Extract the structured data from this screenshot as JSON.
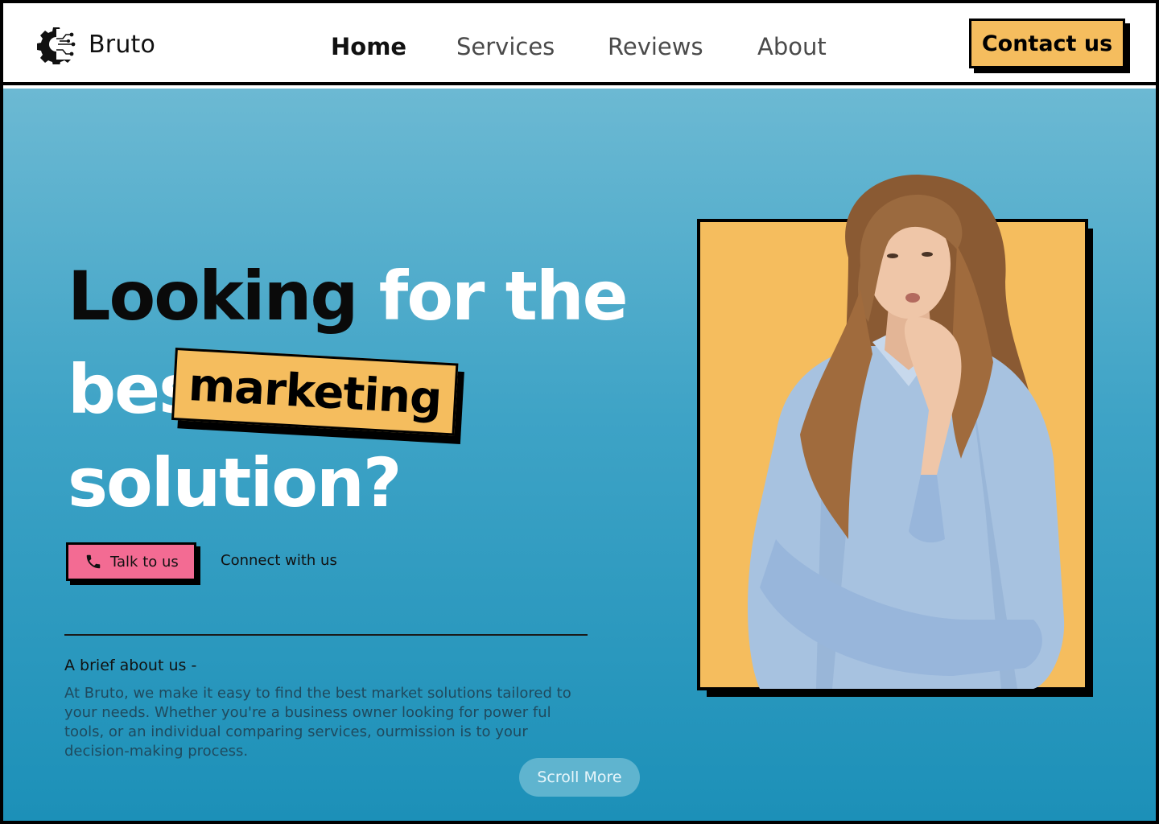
{
  "brand": {
    "name": "Bruto",
    "logo_icon": "gear-circuit-icon"
  },
  "nav": {
    "links": [
      {
        "label": "Home",
        "active": true
      },
      {
        "label": "Services",
        "active": false
      },
      {
        "label": "Reviews",
        "active": false
      },
      {
        "label": "About",
        "active": false
      }
    ],
    "contact_label": "Contact us"
  },
  "hero": {
    "line1_dark": "Looking",
    "line1_white": "for the",
    "line2_white": "best",
    "tag": "marketing",
    "line3_white": "solution?",
    "talk_label": "Talk to us",
    "talk_icon": "phone-icon",
    "connect_label": "Connect with us",
    "brief_title": "A brief about us -",
    "brief_text": "At Bruto, we make it easy to find the best market solutions tailored to your needs. Whether you're a business owner looking for power ful tools, or an individual comparing services, ourmission is to your decision-making process.",
    "scroll_label": "Scroll More"
  },
  "colors": {
    "accent_yellow": "#f5bd5e",
    "accent_pink": "#f36b93",
    "hero_top": "#6cb9d3",
    "hero_bottom": "#1c90b8"
  }
}
